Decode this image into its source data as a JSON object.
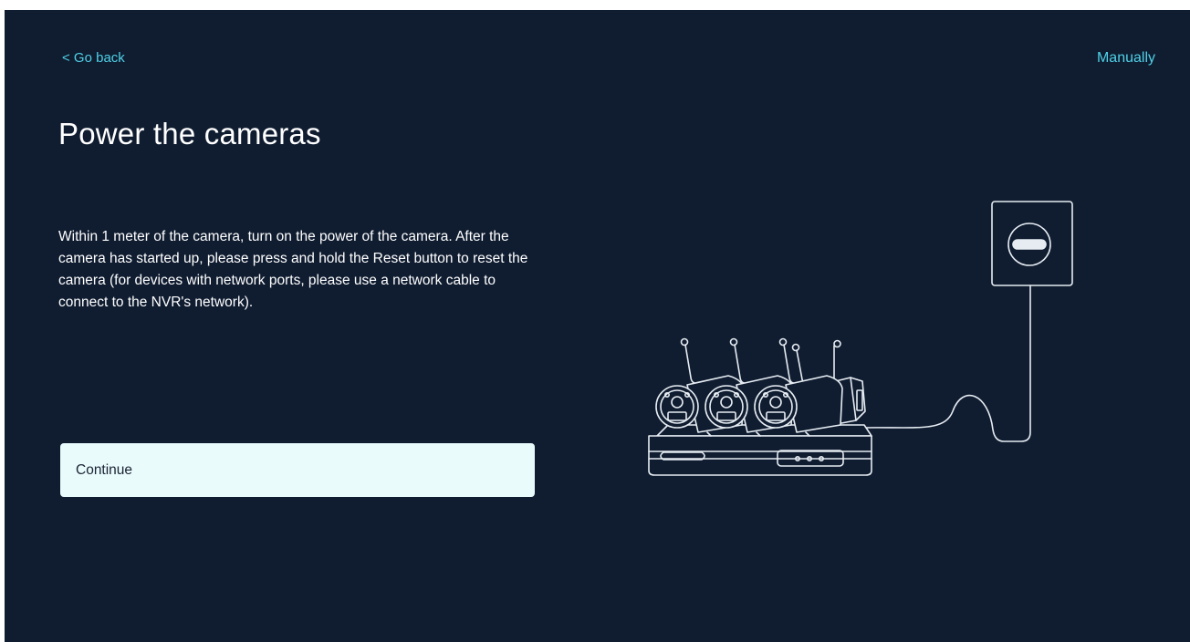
{
  "header": {
    "back_label": "< Go back",
    "manually_label": "Manually"
  },
  "main": {
    "title": "Power the cameras",
    "description": "Within 1 meter of the camera, turn on the power of the camera. After the camera has started up, please press and hold the Reset button to reset the camera (for devices with network ports, please use a network cable to connect to the NVR's network).",
    "continue_label": "Continue"
  },
  "illustration": {
    "camera_count": 4,
    "icons": [
      "power-outlet-icon",
      "nvr-recorder-icon",
      "camera-icon",
      "power-cable-icon"
    ]
  },
  "colors": {
    "background": "#101d31",
    "accent": "#4fd0e6",
    "button_bg": "#e9fbfb",
    "text": "#ffffff",
    "line_art": "#e6ecf2"
  }
}
